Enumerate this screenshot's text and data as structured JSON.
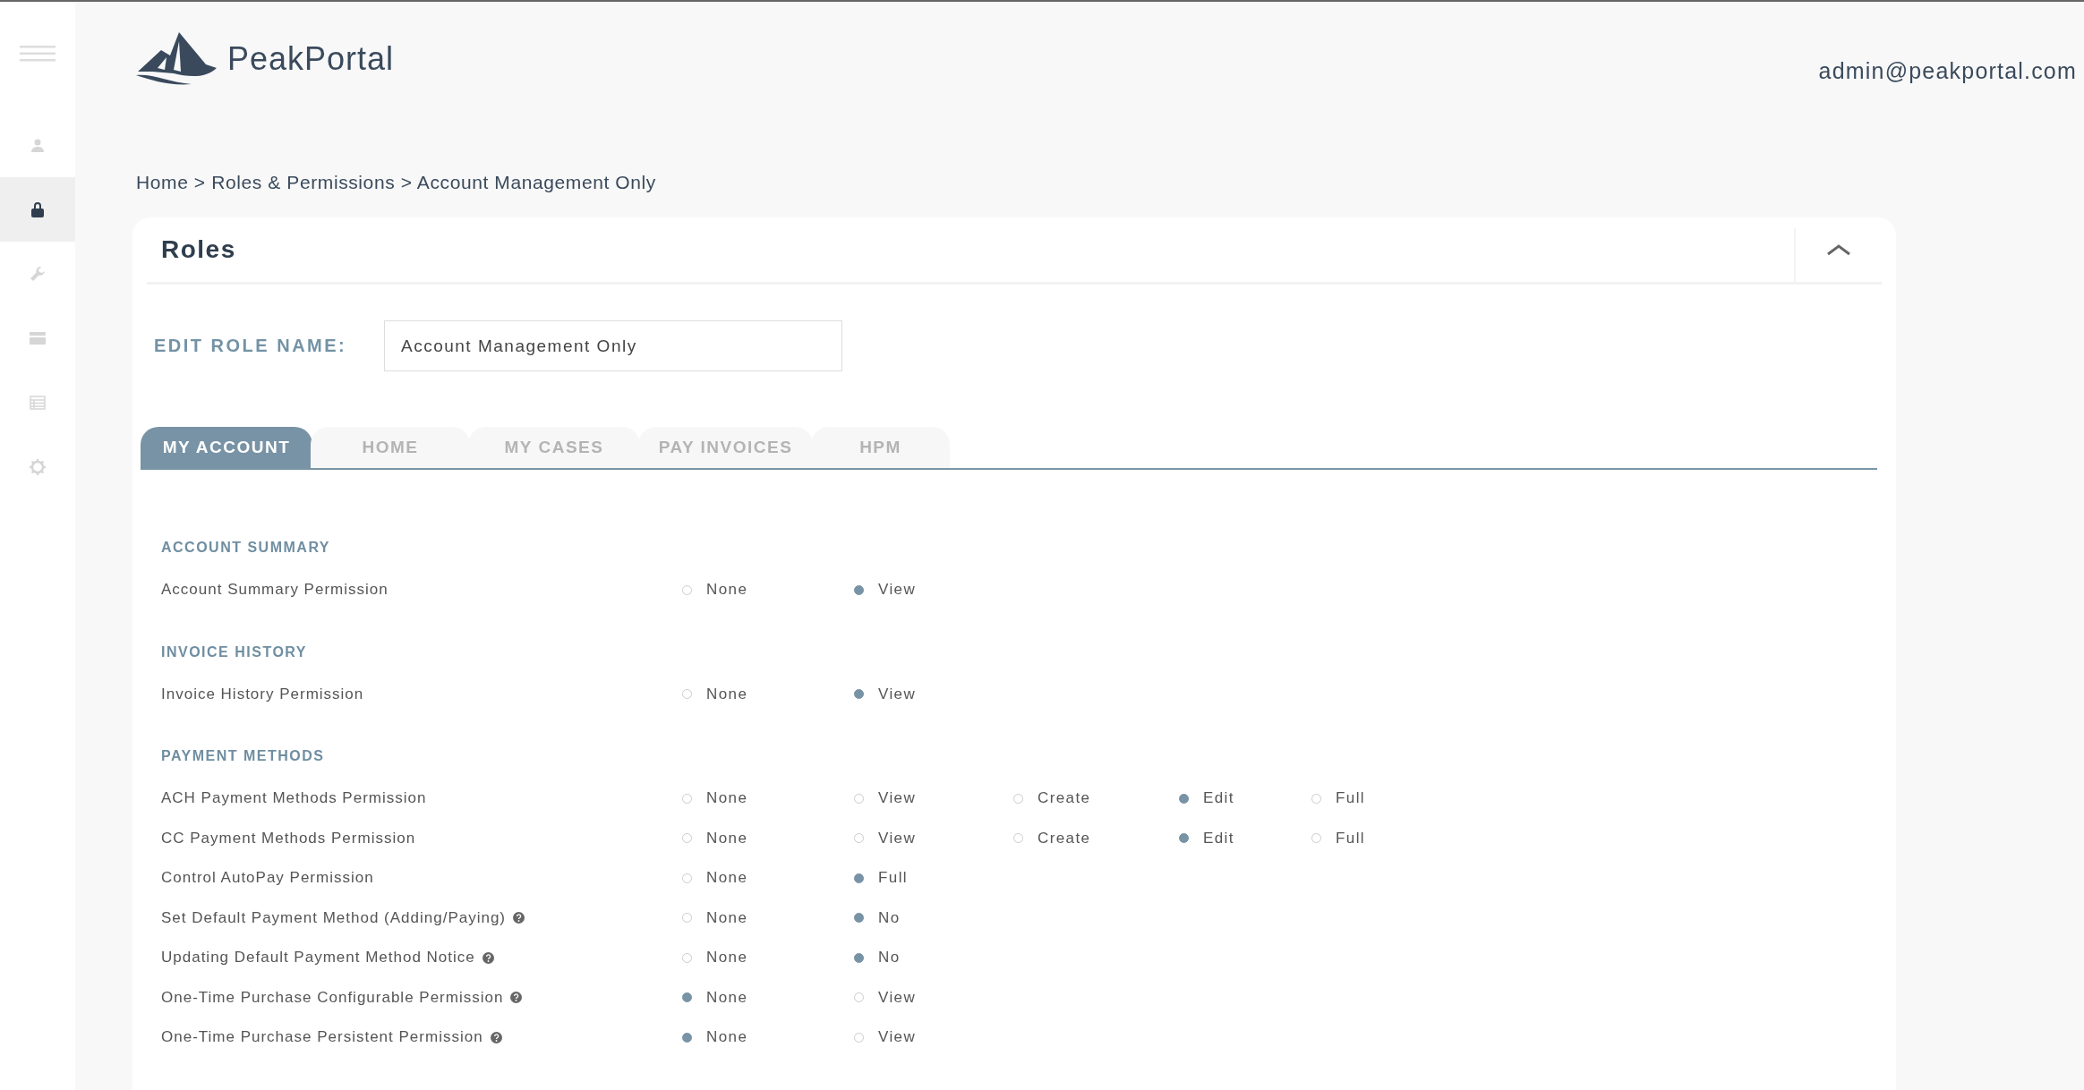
{
  "sidebar": {
    "items": [
      {
        "kind": "menu",
        "selected": false
      },
      {
        "kind": "user",
        "selected": false
      },
      {
        "kind": "lock",
        "selected": true
      },
      {
        "kind": "wrench",
        "selected": false
      },
      {
        "kind": "card",
        "selected": false
      },
      {
        "kind": "table",
        "selected": false
      },
      {
        "kind": "gear",
        "selected": false
      }
    ]
  },
  "header": {
    "brand": "PeakPortal",
    "user_email": "admin@peakportal.com"
  },
  "breadcrumb": "Home > Roles & Permissions > Account Management Only",
  "panel": {
    "title": "Roles",
    "expanded": true,
    "role_name_label": "EDIT ROLE NAME:",
    "role_name_value": "Account Management Only",
    "tabs": [
      {
        "label": "MY ACCOUNT",
        "selected": true
      },
      {
        "label": "HOME",
        "selected": false
      },
      {
        "label": "MY CASES",
        "selected": false
      },
      {
        "label": "PAY INVOICES",
        "selected": false
      },
      {
        "label": "HPM",
        "selected": false
      }
    ],
    "sections": [
      {
        "heading": "ACCOUNT SUMMARY",
        "rows": [
          {
            "label": "Account Summary Permission",
            "help": false,
            "options": [
              {
                "label": "None",
                "selected": false
              },
              {
                "label": "View",
                "selected": true
              }
            ]
          }
        ]
      },
      {
        "heading": "INVOICE HISTORY",
        "rows": [
          {
            "label": "Invoice History Permission",
            "help": false,
            "options": [
              {
                "label": "None",
                "selected": false
              },
              {
                "label": "View",
                "selected": true
              }
            ]
          }
        ]
      },
      {
        "heading": "PAYMENT METHODS",
        "rows": [
          {
            "label": "ACH Payment Methods Permission",
            "help": false,
            "options": [
              {
                "label": "None",
                "selected": false
              },
              {
                "label": "View",
                "selected": false
              },
              {
                "label": "Create",
                "selected": false
              },
              {
                "label": "Edit",
                "selected": true
              },
              {
                "label": "Full",
                "selected": false
              }
            ]
          },
          {
            "label": "CC Payment Methods Permission",
            "help": false,
            "options": [
              {
                "label": "None",
                "selected": false
              },
              {
                "label": "View",
                "selected": false
              },
              {
                "label": "Create",
                "selected": false
              },
              {
                "label": "Edit",
                "selected": true
              },
              {
                "label": "Full",
                "selected": false
              }
            ]
          },
          {
            "label": "Control AutoPay Permission",
            "help": false,
            "options": [
              {
                "label": "None",
                "selected": false
              },
              {
                "label": "Full",
                "selected": true
              }
            ]
          },
          {
            "label": "Set Default Payment Method (Adding/Paying)",
            "help": true,
            "options": [
              {
                "label": "None",
                "selected": false
              },
              {
                "label": "No",
                "selected": true
              }
            ]
          },
          {
            "label": "Updating Default Payment Method Notice",
            "help": true,
            "options": [
              {
                "label": "None",
                "selected": false
              },
              {
                "label": "No",
                "selected": true
              }
            ]
          },
          {
            "label": "One-Time Purchase Configurable Permission",
            "help": true,
            "options": [
              {
                "label": "None",
                "selected": true
              },
              {
                "label": "View",
                "selected": false
              }
            ]
          },
          {
            "label": "One-Time Purchase Persistent Permission",
            "help": true,
            "options": [
              {
                "label": "None",
                "selected": true
              },
              {
                "label": "View",
                "selected": false
              }
            ]
          }
        ]
      }
    ]
  }
}
